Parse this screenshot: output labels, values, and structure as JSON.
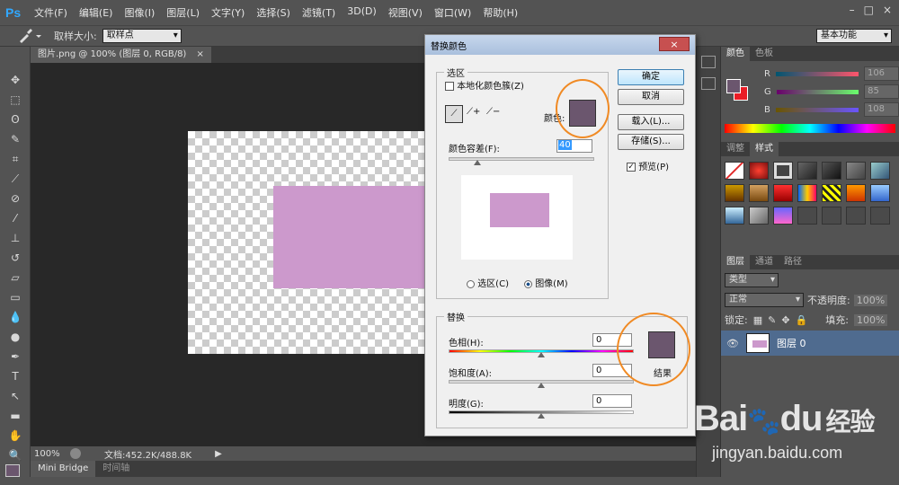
{
  "app": {
    "logo": "Ps"
  },
  "menu": [
    "文件(F)",
    "编辑(E)",
    "图像(I)",
    "图层(L)",
    "文字(Y)",
    "选择(S)",
    "滤镜(T)",
    "3D(D)",
    "视图(V)",
    "窗口(W)",
    "帮助(H)"
  ],
  "window_buttons": [
    "–",
    "□",
    "×"
  ],
  "options_bar": {
    "sample_size_label": "取样大小:",
    "sample_size_value": "取样点",
    "workspace": "基本功能"
  },
  "document": {
    "tab_title": "图片.png @ 100% (图层 0, RGB/8)",
    "tab_close": "×"
  },
  "image": {
    "rect_color": "#cc99cc"
  },
  "status": {
    "zoom": "100%",
    "doc_info": "文档:452.2K/488.8K"
  },
  "bottom_tabs": [
    "Mini Bridge",
    "时间轴"
  ],
  "color_panel": {
    "tabs": [
      "颜色",
      "色板"
    ],
    "channels": [
      {
        "label": "R",
        "value": "106"
      },
      {
        "label": "G",
        "value": "85"
      },
      {
        "label": "B",
        "value": "108"
      }
    ]
  },
  "styles_panel": {
    "tabs": [
      "调整",
      "样式"
    ]
  },
  "layers_panel": {
    "tabs": [
      "图层",
      "通道",
      "路径"
    ],
    "kind": "类型",
    "blend_mode": "正常",
    "opacity_label": "不透明度:",
    "opacity_value": "100%",
    "lock_label": "锁定:",
    "fill_label": "填充:",
    "fill_value": "100%",
    "layer_name": "图层 0"
  },
  "dialog": {
    "title": "替换颜色",
    "close": "×",
    "selection_group": "选区",
    "localized_label": "本地化颜色簇(Z)",
    "color_label": "颜色:",
    "color_swatch": "#6b566e",
    "fuzziness_label": "颜色容差(F):",
    "fuzziness_value": "40",
    "fuzziness": 40,
    "radio_selection": "选区(C)",
    "radio_image": "图像(M)",
    "buttons": {
      "ok": "确定",
      "cancel": "取消",
      "load": "载入(L)...",
      "save": "存储(S)..."
    },
    "preview_label": "预览(P)",
    "replace_group": "替换",
    "hue_label": "色相(H):",
    "hue_value": "0",
    "saturation_label": "饱和度(A):",
    "saturation_value": "0",
    "lightness_label": "明度(G):",
    "lightness_value": "0",
    "result_label": "结果",
    "result_swatch": "#6b566e",
    "preview_rect_color": "#cc99cc"
  },
  "watermark": {
    "brand": "Bai",
    "brand_suffix": "du",
    "cn": "经验",
    "url": "jingyan.baidu.com"
  }
}
